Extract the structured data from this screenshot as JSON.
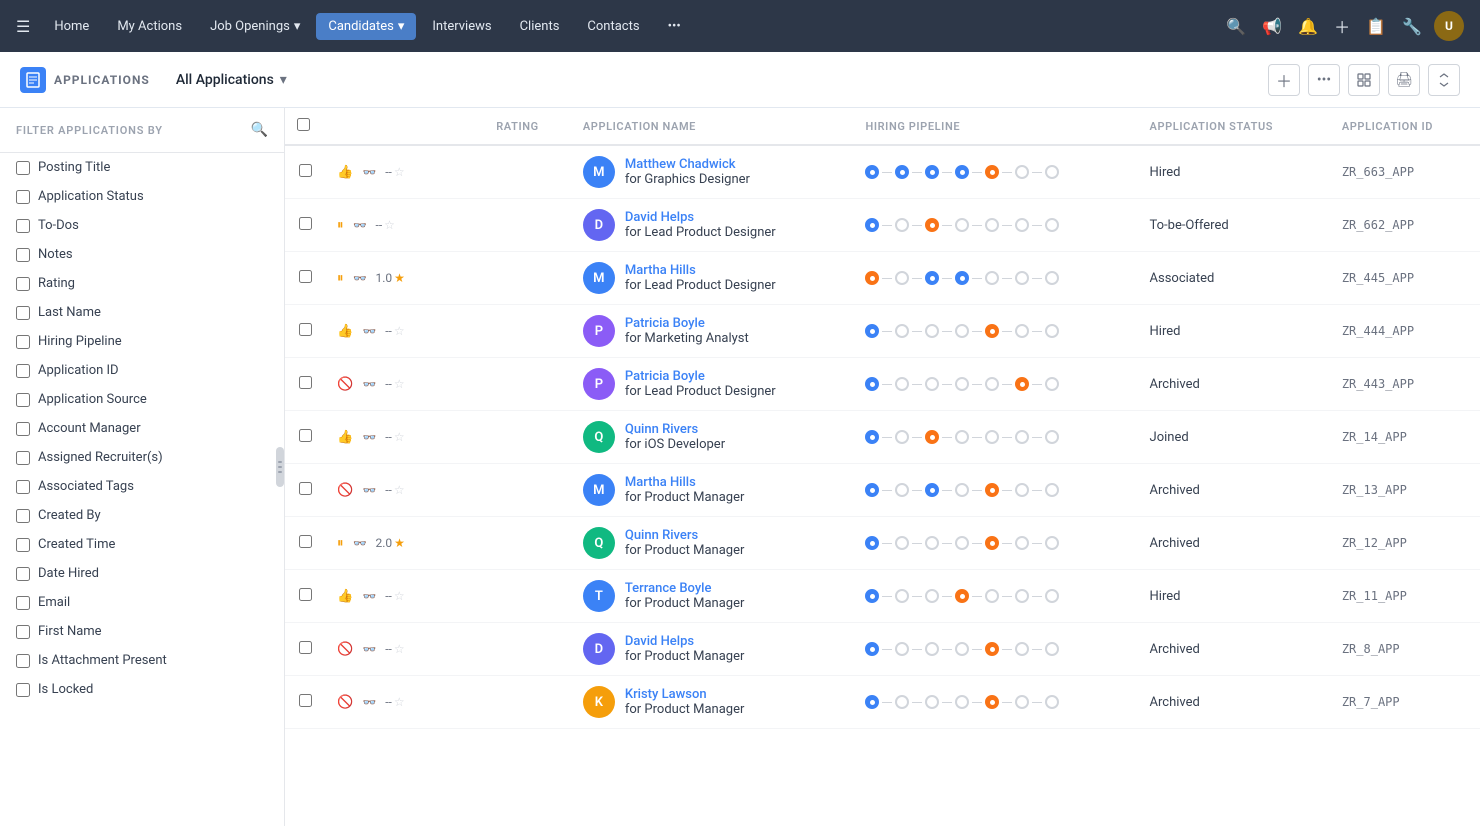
{
  "nav": {
    "hamburger": "☰",
    "items": [
      {
        "id": "home",
        "label": "Home",
        "active": false
      },
      {
        "id": "my-actions",
        "label": "My Actions",
        "active": false
      },
      {
        "id": "job-openings",
        "label": "Job Openings",
        "active": false,
        "dropdown": true
      },
      {
        "id": "candidates",
        "label": "Candidates",
        "active": true,
        "highlighted": true,
        "dropdown": true
      },
      {
        "id": "interviews",
        "label": "Interviews",
        "active": false
      },
      {
        "id": "clients",
        "label": "Clients",
        "active": false
      },
      {
        "id": "contacts",
        "label": "Contacts",
        "active": false
      },
      {
        "id": "more",
        "label": "•••",
        "active": false
      }
    ],
    "icons": [
      "🔍",
      "📢",
      "🔔",
      "+",
      "📋",
      "🔧"
    ],
    "avatar_initials": "U"
  },
  "subheader": {
    "app_icon": "📄",
    "app_title": "APPLICATIONS",
    "view_label": "All Applications",
    "actions": [
      "+",
      "•••",
      "⊞",
      "🖨",
      "⇅"
    ]
  },
  "sidebar": {
    "header": "FILTER APPLICATIONS BY",
    "filters": [
      "Posting Title",
      "Application Status",
      "To-Dos",
      "Notes",
      "Rating",
      "Last Name",
      "Hiring Pipeline",
      "Application ID",
      "Application Source",
      "Account Manager",
      "Assigned Recruiter(s)",
      "Associated Tags",
      "Created By",
      "Created Time",
      "Date Hired",
      "Email",
      "First Name",
      "Is Attachment Present",
      "Is Locked"
    ]
  },
  "table": {
    "columns": [
      "",
      "",
      "RATING",
      "APPLICATION NAME",
      "HIRING PIPELINE",
      "APPLICATION STATUS",
      "APPLICATION ID"
    ],
    "rows": [
      {
        "id": "row-1",
        "thumb": "up",
        "rating": "--",
        "star": false,
        "candidate_name": "Matthew Chadwick",
        "job": "Graphics Designer",
        "avatar_letter": "M",
        "avatar_color": "#3b82f6",
        "pipeline": [
          "filled-blue",
          "filled-blue",
          "filled-blue",
          "filled-blue",
          "filled-orange",
          "empty-gray",
          "empty-gray"
        ],
        "status": "Hired",
        "app_id": "ZR_663_APP"
      },
      {
        "id": "row-2",
        "thumb": "neutral",
        "rating": "--",
        "star": false,
        "candidate_name": "David Helps",
        "job": "Lead Product Designer",
        "avatar_letter": "D",
        "avatar_color": "#6366f1",
        "pipeline": [
          "filled-blue",
          "empty-gray",
          "filled-orange",
          "empty-gray",
          "empty-gray",
          "empty-gray",
          "empty-gray"
        ],
        "status": "To-be-Offered",
        "app_id": "ZR_662_APP"
      },
      {
        "id": "row-3",
        "thumb": "neutral",
        "rating": "1.0",
        "star": true,
        "candidate_name": "Martha Hills",
        "job": "Lead Product Designer",
        "avatar_letter": "M",
        "avatar_color": "#3b82f6",
        "pipeline": [
          "filled-orange",
          "empty-gray",
          "filled-blue",
          "filled-blue",
          "empty-gray",
          "empty-gray",
          "empty-gray"
        ],
        "status": "Associated",
        "app_id": "ZR_445_APP"
      },
      {
        "id": "row-4",
        "thumb": "up",
        "rating": "--",
        "star": false,
        "candidate_name": "Patricia Boyle",
        "job": "Marketing Analyst",
        "avatar_letter": "P",
        "avatar_color": "#8b5cf6",
        "pipeline": [
          "filled-blue",
          "empty-gray",
          "empty-gray",
          "empty-gray",
          "filled-orange",
          "empty-gray",
          "empty-gray"
        ],
        "status": "Hired",
        "app_id": "ZR_444_APP"
      },
      {
        "id": "row-5",
        "thumb": "down",
        "rating": "--",
        "star": false,
        "candidate_name": "Patricia Boyle",
        "job": "Lead Product Designer",
        "avatar_letter": "P",
        "avatar_color": "#8b5cf6",
        "pipeline": [
          "filled-blue",
          "empty-gray",
          "empty-gray",
          "empty-gray",
          "empty-gray",
          "filled-orange",
          "empty-gray"
        ],
        "status": "Archived",
        "app_id": "ZR_443_APP"
      },
      {
        "id": "row-6",
        "thumb": "up",
        "rating": "--",
        "star": false,
        "candidate_name": "Quinn Rivers",
        "job": "iOS Developer",
        "avatar_letter": "Q",
        "avatar_color": "#10b981",
        "pipeline": [
          "filled-blue",
          "empty-gray",
          "filled-orange",
          "empty-gray",
          "empty-gray",
          "empty-gray",
          "empty-gray"
        ],
        "status": "Joined",
        "app_id": "ZR_14_APP"
      },
      {
        "id": "row-7",
        "thumb": "down",
        "rating": "--",
        "star": false,
        "candidate_name": "Martha Hills",
        "job": "Product Manager",
        "avatar_letter": "M",
        "avatar_color": "#3b82f6",
        "pipeline": [
          "filled-blue",
          "empty-gray",
          "filled-blue",
          "empty-gray",
          "filled-orange",
          "empty-gray",
          "empty-gray"
        ],
        "status": "Archived",
        "app_id": "ZR_13_APP"
      },
      {
        "id": "row-8",
        "thumb": "neutral",
        "rating": "2.0",
        "star": true,
        "candidate_name": "Quinn Rivers",
        "job": "Product Manager",
        "avatar_letter": "Q",
        "avatar_color": "#10b981",
        "pipeline": [
          "filled-blue",
          "empty-gray",
          "empty-gray",
          "empty-gray",
          "filled-orange",
          "empty-gray",
          "empty-gray"
        ],
        "status": "Archived",
        "app_id": "ZR_12_APP"
      },
      {
        "id": "row-9",
        "thumb": "up",
        "rating": "--",
        "star": false,
        "candidate_name": "Terrance Boyle",
        "job": "Product Manager",
        "avatar_letter": "T",
        "avatar_color": "#3b82f6",
        "pipeline": [
          "filled-blue",
          "empty-gray",
          "empty-gray",
          "filled-orange",
          "empty-gray",
          "empty-gray",
          "empty-gray"
        ],
        "status": "Hired",
        "app_id": "ZR_11_APP"
      },
      {
        "id": "row-10",
        "thumb": "down",
        "rating": "--",
        "star": false,
        "candidate_name": "David Helps",
        "job": "Product Manager",
        "avatar_letter": "D",
        "avatar_color": "#6366f1",
        "pipeline": [
          "filled-blue",
          "empty-gray",
          "empty-gray",
          "empty-gray",
          "filled-orange",
          "empty-gray",
          "empty-gray"
        ],
        "status": "Archived",
        "app_id": "ZR_8_APP"
      },
      {
        "id": "row-11",
        "thumb": "down",
        "rating": "--",
        "star": false,
        "candidate_name": "Kristy Lawson",
        "job": "Product Manager",
        "avatar_letter": "K",
        "avatar_color": "#f59e0b",
        "pipeline": [
          "filled-blue",
          "empty-gray",
          "empty-gray",
          "empty-gray",
          "filled-orange",
          "empty-gray",
          "empty-gray"
        ],
        "status": "Archived",
        "app_id": "ZR_7_APP"
      }
    ]
  }
}
